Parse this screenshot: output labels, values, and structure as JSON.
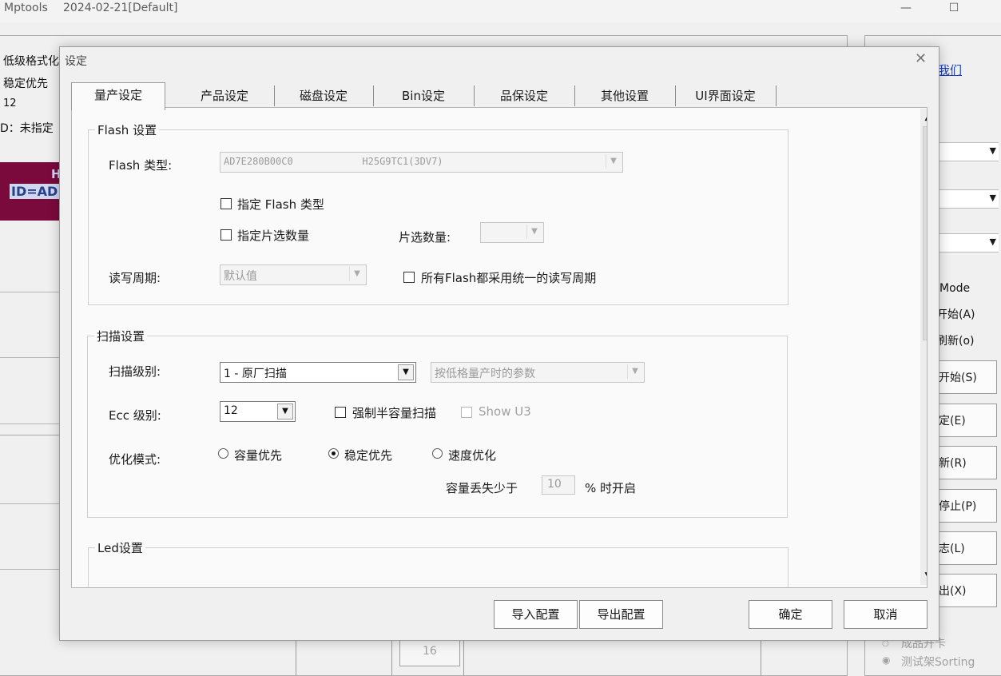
{
  "window": {
    "title": "Mptools",
    "subtitle": "2024-02-21[Default]",
    "minimize": "—",
    "maximize": "☐"
  },
  "background": {
    "left_lines": [
      "低级格式化",
      "稳定优先",
      "12",
      "D：未指定"
    ],
    "maroon_h": "H",
    "maroon_id": "ID=AD",
    "link": "我们",
    "right_labels": [
      "Mode",
      "开始(A)",
      "刷新(o)"
    ],
    "right_buttons": [
      "开始(S)",
      "定(E)",
      "新(R)",
      "停止(P)",
      "志(L)",
      "出(X)"
    ],
    "bottom_badge": "16",
    "bottom_radios": [
      "成品开卡",
      "测试架Sorting"
    ]
  },
  "dialog": {
    "title": "设定",
    "close": "✕",
    "tabs": [
      "量产设定",
      "产品设定",
      "磁盘设定",
      "Bin设定",
      "品保设定",
      "其他设置",
      "UI界面设定"
    ],
    "flash": {
      "group": "Flash 设置",
      "type_label": "Flash 类型:",
      "type_value": "AD7E280B00C0            H25G9TC1(3DV7)",
      "chk_specify_type": "指定 Flash 类型",
      "chk_specify_ce": "指定片选数量",
      "ce_count_label": "片选数量:",
      "rw_cycle_label": "读写周期:",
      "rw_cycle_value": "默认值",
      "chk_unified_cycle": "所有Flash都采用统一的读写周期"
    },
    "scan": {
      "group": "扫描设置",
      "level_label": "扫描级别:",
      "level_value": "1 - 原厂扫描",
      "param_value": "按低格量产时的参数",
      "ecc_label": "Ecc 级别:",
      "ecc_value": "12",
      "chk_half_capacity": "强制半容量扫描",
      "chk_show_u3": "Show U3",
      "opt_label": "优化模式:",
      "radio_capacity": "容量优先",
      "radio_stability": "稳定优先",
      "radio_speed": "速度优化",
      "loss_label": "容量丢失少于",
      "loss_value": "10",
      "loss_suffix": "% 时开启"
    },
    "led": {
      "group": "Led设置"
    },
    "buttons": {
      "import": "导入配置",
      "export": "导出配置",
      "ok": "确定",
      "cancel": "取消"
    }
  }
}
